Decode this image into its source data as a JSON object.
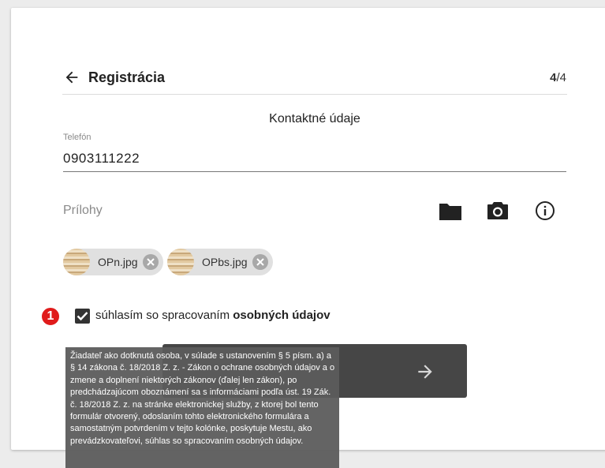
{
  "header": {
    "title": "Registrácia",
    "step_current": "4",
    "step_total": "/4"
  },
  "section": {
    "title": "Kontaktné údaje"
  },
  "phone": {
    "label": "Telefón",
    "value": "0903111222"
  },
  "attachments": {
    "label": "Prílohy",
    "actions": [
      "folder-icon",
      "camera-icon",
      "info-icon"
    ],
    "files": [
      {
        "name": "OPn.jpg"
      },
      {
        "name": "OPbs.jpg"
      }
    ]
  },
  "annotation": {
    "number": "1",
    "color": "#e01b1b"
  },
  "consent": {
    "checked": true,
    "text_prefix": "súhlasím so spracovaním ",
    "text_bold": "osobných údajov"
  },
  "submit": {
    "icon": "arrow-right-icon"
  },
  "tooltip": {
    "text": "Žiadateľ ako dotknutá osoba, v súlade s ustanovením § 5 písm. a) a § 14 zákona č. 18/2018 Z. z. - Zákon o ochrane osobných údajov a o zmene a doplnení niektorých zákonov (ďalej len zákon), po predchádzajúcom oboznámení sa s informáciami podľa úst. 19 Zák. č. 18/2018 Z. z. na stránke elektronickej služby, z ktorej bol tento formulár otvorený, odoslaním tohto elektronického formulára a samostatným potvrdením v tejto kolónke, poskytuje Mestu, ako prevádzkovateľovi, súhlas so spracovaním osobných údajov."
  },
  "colors": {
    "primary_dark": "#464646",
    "checkbox": "#333333",
    "chip_bg": "#e0e0e0",
    "tooltip_bg": "#5c5c5c"
  }
}
